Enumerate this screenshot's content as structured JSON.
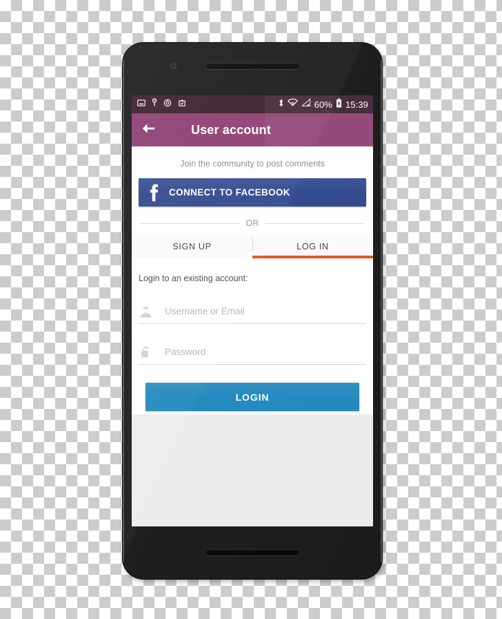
{
  "device": {
    "name": "android-smartphone",
    "earpiece": "earpiece-speaker",
    "front_camera": "front-camera",
    "bottom_speaker": "bottom-speaker"
  },
  "statusbar": {
    "left_icons": [
      {
        "name": "screenshot-icon",
        "label": "screenshot"
      },
      {
        "name": "usb-debug-icon",
        "label": "usb"
      },
      {
        "name": "alarm-icon",
        "label": "alarm"
      },
      {
        "name": "app-update-icon",
        "label": "update"
      }
    ],
    "right_icons": [
      {
        "name": "bluetooth-icon",
        "label": "bluetooth"
      },
      {
        "name": "wifi-icon",
        "label": "wifi"
      },
      {
        "name": "cellular-signal-icon",
        "label": "signal"
      }
    ],
    "battery_percent": "60%",
    "battery_icon": "battery-charging-icon",
    "clock": "15:39",
    "background_color": "#3d2030"
  },
  "appbar": {
    "back_icon": "back-arrow-icon",
    "title": "User account",
    "background_color": "#8e3f72"
  },
  "content": {
    "join_text": "Join the community to post comments",
    "facebook_button": {
      "label": "CONNECT TO FACEBOOK",
      "icon": "facebook-f-icon",
      "color": "#32498e"
    },
    "divider_text": "OR",
    "tabs": [
      {
        "name": "sign-up",
        "label": "SIGN UP",
        "selected": false
      },
      {
        "name": "log-in",
        "label": "LOG IN",
        "selected": true
      }
    ],
    "tab_indicator_color": "#e2561d",
    "form": {
      "heading": "Login to an existing account:",
      "username_field": {
        "icon": "person-icon",
        "placeholder": "Username or Email",
        "value": ""
      },
      "password_field": {
        "icon": "unlocked-padlock-icon",
        "placeholder": "Password",
        "value": ""
      },
      "submit": {
        "label": "LOGIN",
        "color": "#2389bd"
      }
    }
  }
}
